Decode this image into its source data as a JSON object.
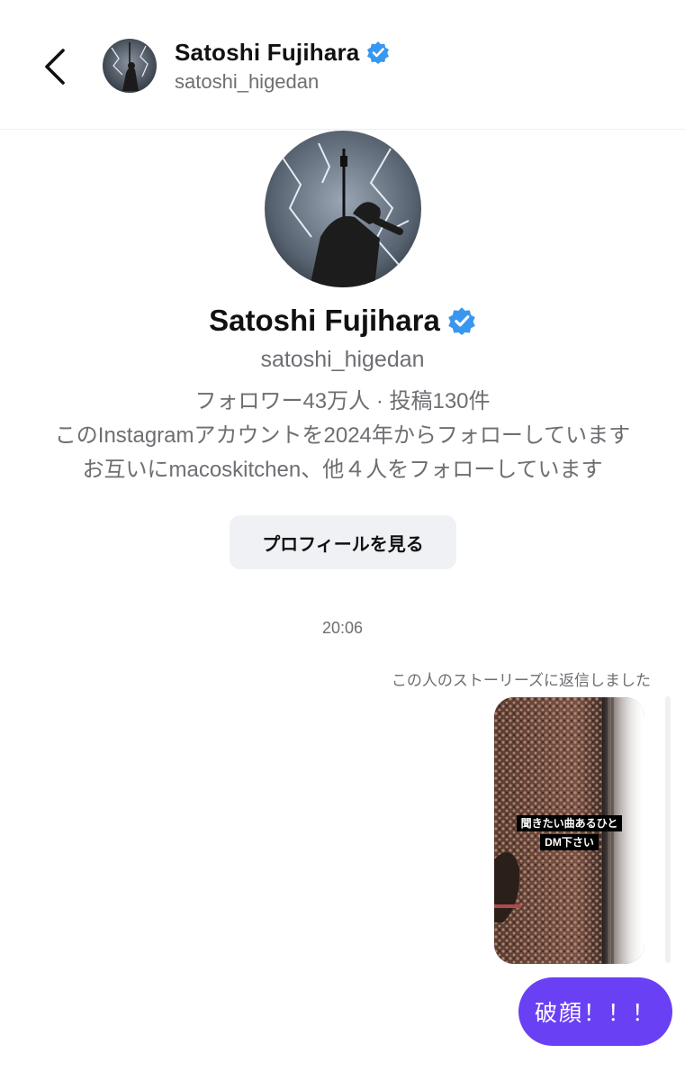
{
  "header": {
    "back_icon": "chevron-left-icon",
    "display_name": "Satoshi Fujihara",
    "verified_icon": "verified-badge-icon",
    "username": "satoshi_higedan"
  },
  "profile": {
    "display_name": "Satoshi Fujihara",
    "username": "satoshi_higedan",
    "stats": "フォロワー43万人 · 投稿130件",
    "follow_since": "このInstagramアカウントを2024年からフォローしています",
    "mutual": "お互いにmacoskitchen、他４人をフォローしています",
    "view_profile_label": "プロフィールを見る"
  },
  "thread": {
    "timestamp": "20:06",
    "reply_note": "この人のストーリーズに返信しました",
    "story_caption_line1": "聞きたい曲あるひと",
    "story_caption_line2": "DM下さい",
    "message": "破顔！！！"
  },
  "colors": {
    "verified": "#3897f0",
    "bubble": "#6a40f5",
    "secondary_text": "#6e6e73",
    "button_bg": "#eff1f4"
  }
}
